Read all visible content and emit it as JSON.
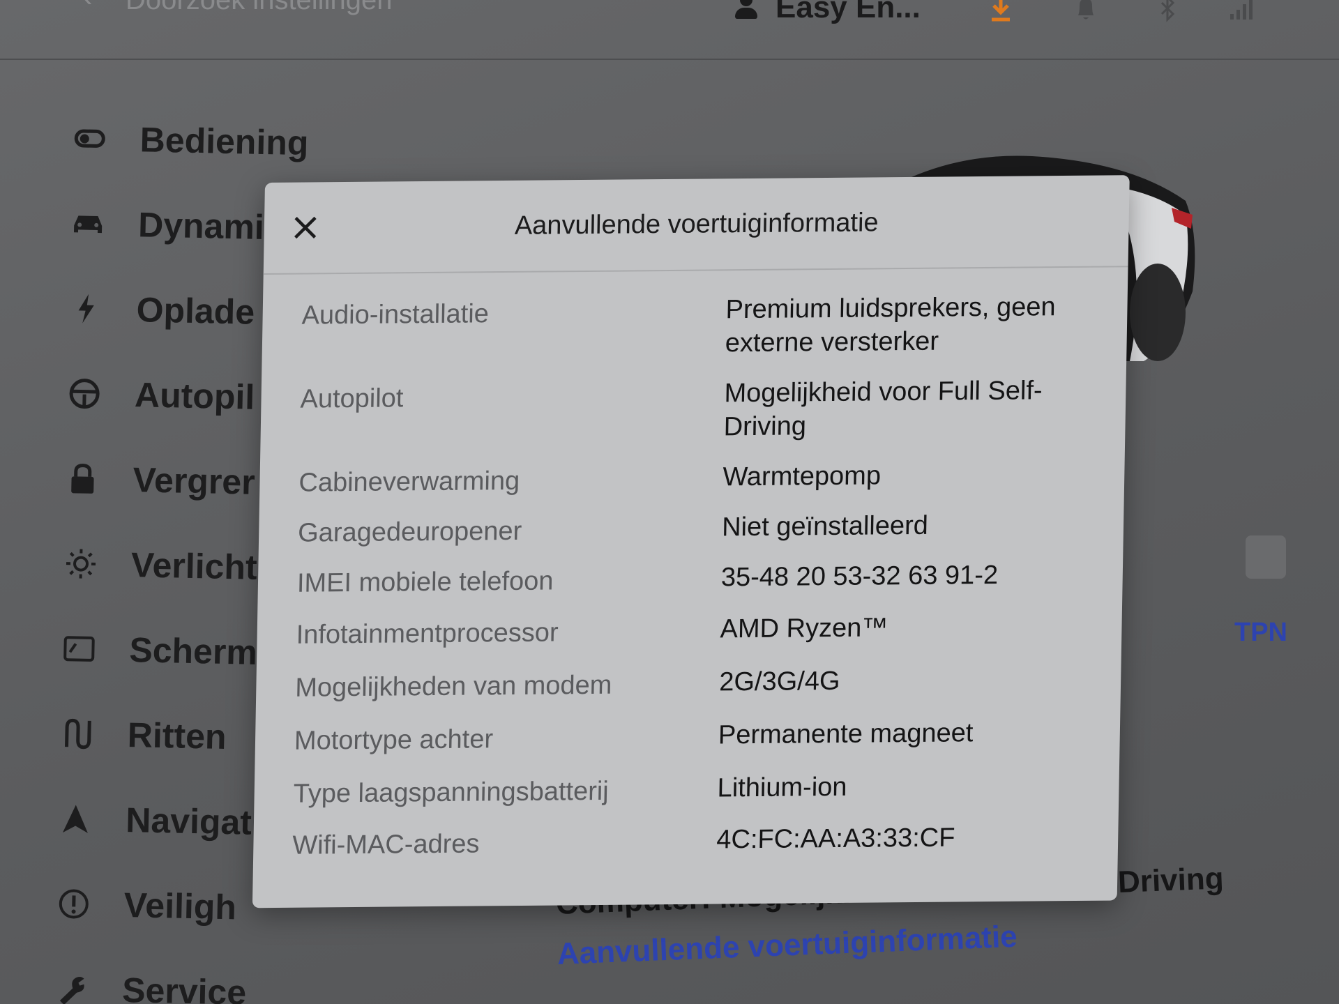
{
  "topbar": {
    "search_label": "Doorzoek instellingen",
    "profile_name": "Easy En..."
  },
  "icons": {
    "back": "chevron-left-icon",
    "person": "person-icon",
    "download": "download-icon",
    "bell": "bell-icon",
    "bluetooth": "bluetooth-icon",
    "signal": "signal-icon",
    "close": "close-icon"
  },
  "colors": {
    "download_accent": "#e07a1d",
    "link_blue": "#2d43b0",
    "modal_bg": "#c2c3c5",
    "backdrop": "#5c5d5f"
  },
  "sidebar": {
    "items": [
      {
        "label": "Bediening",
        "icon": "toggle-icon"
      },
      {
        "label": "Dynami",
        "icon": "car-icon"
      },
      {
        "label": "Oplade",
        "icon": "lightning-icon"
      },
      {
        "label": "Autopil",
        "icon": "steering-wheel-icon"
      },
      {
        "label": "Vergrer",
        "icon": "lock-icon"
      },
      {
        "label": "Verlicht",
        "icon": "sun-icon"
      },
      {
        "label": "Scherm",
        "icon": "display-icon"
      },
      {
        "label": "Ritten",
        "icon": "trips-icon"
      },
      {
        "label": "Navigat",
        "icon": "navigation-arrow-icon"
      },
      {
        "label": "Veiligh",
        "icon": "alert-circle-icon"
      },
      {
        "label": "Service",
        "icon": "wrench-icon"
      }
    ]
  },
  "background": {
    "computer_line": "Computer: Mogelijkheid voor Full Self-Driving",
    "more_info_link": "Aanvullende voertuiginformatie",
    "tpn": "TPN"
  },
  "modal": {
    "title": "Aanvullende voertuiginformatie",
    "rows": [
      {
        "key": "Audio-installatie",
        "value": "Premium luidsprekers, geen externe versterker"
      },
      {
        "key": "Autopilot",
        "value": "Mogelijkheid voor Full Self-Driving"
      },
      {
        "key": "Cabineverwarming",
        "value": "Warmtepomp"
      },
      {
        "key": "Garagedeuropener",
        "value": "Niet geïnstalleerd"
      },
      {
        "key": "IMEI mobiele telefoon",
        "value": "35-48 20 53-32 63 91-2"
      },
      {
        "key": "Infotainmentprocessor",
        "value": "AMD Ryzen™"
      },
      {
        "key": "Mogelijkheden van modem",
        "value": "2G/3G/4G"
      },
      {
        "key": "Motortype achter",
        "value": "Permanente magneet"
      },
      {
        "key": "Type laagspanningsbatterij",
        "value": "Lithium-ion"
      },
      {
        "key": "Wifi-MAC-adres",
        "value": "4C:FC:AA:A3:33:CF"
      }
    ]
  }
}
